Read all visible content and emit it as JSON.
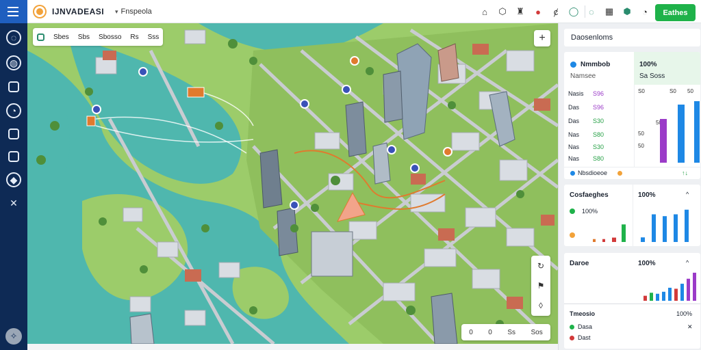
{
  "app": {
    "brand": "IJNVADEASI",
    "project": "Fnspeola",
    "cta": "Eathes"
  },
  "toolbar": {
    "icons": [
      "building-icon",
      "shield-icon",
      "pin-icon",
      "user-icon",
      "plug-icon",
      "circle-icon",
      "chat-icon",
      "grid-icon",
      "gear-icon",
      "bell-icon"
    ]
  },
  "rail": {
    "icons": [
      "globe-icon",
      "shield-icon",
      "cube-icon",
      "bell-icon",
      "list-icon",
      "layers-icon",
      "tag-icon",
      "tools-icon"
    ],
    "bottom_icon": "compass-icon"
  },
  "map": {
    "chips": [
      "Sbes",
      "Sbs",
      "Sbosso",
      "Rs",
      "Sss"
    ],
    "zoom_in": "+",
    "vertical_tools": [
      "rotate-icon",
      "flag-icon",
      "drop-icon"
    ],
    "bottom_tools": [
      "0",
      "0",
      "Ss",
      "Sos"
    ],
    "colors": {
      "water": "#4fb7ae",
      "land": "#9ccc6a",
      "road": "#c9ccd1",
      "route": "#e07a2e"
    }
  },
  "panel": {
    "title": "Daosenloms",
    "card1": {
      "head_left_1": "Nmmbob",
      "head_left_2": "Namsee",
      "head_right_1": "100%",
      "head_right_2": "Sa Soss",
      "rows": [
        {
          "label": "Nasis",
          "value": "S96"
        },
        {
          "label": "Das",
          "value": "S96"
        },
        {
          "label": "Das",
          "value": "S30"
        },
        {
          "label": "Nas",
          "value": "S80"
        },
        {
          "label": "Nas",
          "value": "S30"
        },
        {
          "label": "Nas",
          "value": "S80"
        }
      ],
      "legend": "Nbsdioeoe"
    },
    "card2": {
      "title": "Cosfaeghes",
      "row1": "100%",
      "pct": "100%"
    },
    "card3": {
      "title": "Daroe",
      "pct": "100%",
      "footer_title": "Tmeosio",
      "footer_pct": "100%",
      "row1": "Dasa",
      "row2": "Dast"
    }
  },
  "chart_data": [
    {
      "type": "bar",
      "series": [
        {
          "color": "#9b3bc8",
          "values": [
            64
          ]
        },
        {
          "color": "#1e88e5",
          "values": [
            85
          ]
        },
        {
          "color": "#1e88e5",
          "values": [
            90
          ]
        }
      ],
      "ticks": [
        "S0",
        "S0",
        "50",
        "50",
        "50",
        "50"
      ]
    },
    {
      "type": "bar",
      "series": [
        {
          "name": "left",
          "values": [
            2,
            2,
            3,
            12
          ]
        },
        {
          "name": "right",
          "values": [
            5,
            30,
            28,
            30,
            35
          ]
        }
      ]
    },
    {
      "type": "bar",
      "series": [
        {
          "values": [
            5,
            8,
            7,
            9,
            13,
            12,
            17,
            22,
            28
          ]
        }
      ]
    }
  ]
}
